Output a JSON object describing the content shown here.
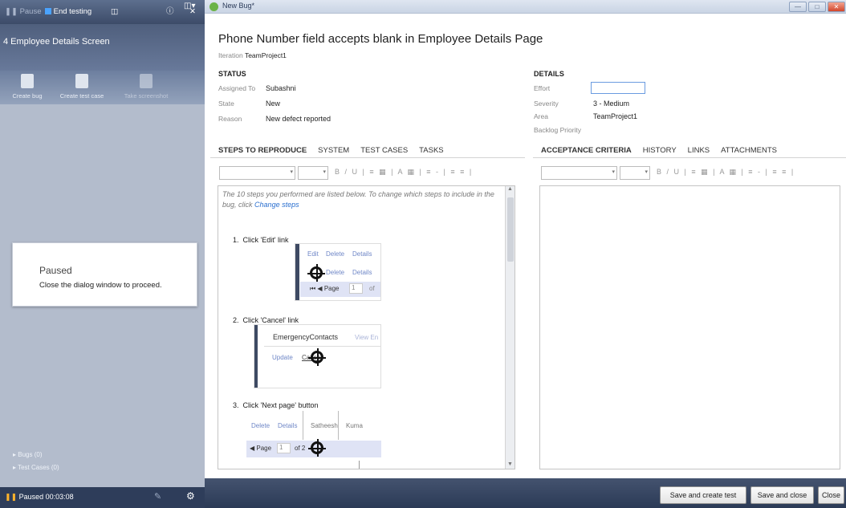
{
  "left_panel": {
    "top_bar": {
      "pause": "Pause",
      "end_testing": "End testing"
    },
    "title": "4 Employee Details Screen",
    "tools": [
      "Create bug",
      "Create test case",
      "Take screenshot"
    ],
    "paused": {
      "title": "Paused",
      "message": "Close the dialog window to proceed."
    },
    "links": [
      "Bugs (0)",
      "Test Cases (0)"
    ],
    "status": "Paused 00:03:08"
  },
  "window": {
    "tab": "New Bug*"
  },
  "bug": {
    "title": "Phone Number field accepts blank in Employee Details Page",
    "iteration_label": "Iteration",
    "iteration": "TeamProject1"
  },
  "status_section": {
    "header": "STATUS",
    "fields": [
      {
        "label": "Assigned To",
        "value": "Subashni"
      },
      {
        "label": "State",
        "value": "New"
      },
      {
        "label": "Reason",
        "value": "New defect reported"
      }
    ]
  },
  "details_section": {
    "header": "DETAILS",
    "fields": [
      {
        "label": "Effort",
        "value": ""
      },
      {
        "label": "Severity",
        "value": "3 - Medium"
      },
      {
        "label": "Area",
        "value": "TeamProject1"
      },
      {
        "label": "Backlog Priority",
        "value": ""
      }
    ]
  },
  "left_tabs": [
    "STEPS TO REPRODUCE",
    "SYSTEM",
    "TEST CASES",
    "TASKS"
  ],
  "right_tabs": [
    "ACCEPTANCE CRITERIA",
    "HISTORY",
    "LINKS",
    "ATTACHMENTS"
  ],
  "steps": {
    "intro": "The 10 steps you performed are listed below. To change which steps to include in the bug, click",
    "intro_link": "Change steps",
    "items": [
      {
        "num": "1.",
        "text": "Click 'Edit' link"
      },
      {
        "num": "2.",
        "text": "Click 'Cancel' link"
      },
      {
        "num": "3.",
        "text": "Click 'Next page' button"
      }
    ],
    "shot1": {
      "edit": "Edit",
      "delete": "Delete",
      "details": "Details",
      "delete2": "Delete",
      "details2": "Details",
      "page": "Page",
      "page_num": "1",
      "of": "of"
    },
    "shot2": {
      "contacts": "EmergencyContacts",
      "view": "View En",
      "update": "Update",
      "cancel": "Cancel"
    },
    "shot3": {
      "delete": "Delete",
      "details": "Details",
      "name": "Satheesh",
      "name2": "Kuma",
      "page": "Page",
      "page_num": "1",
      "of": "of 2"
    }
  },
  "buttons": {
    "save_create": "Save and create test",
    "save_close": "Save and close",
    "close": "Close"
  }
}
